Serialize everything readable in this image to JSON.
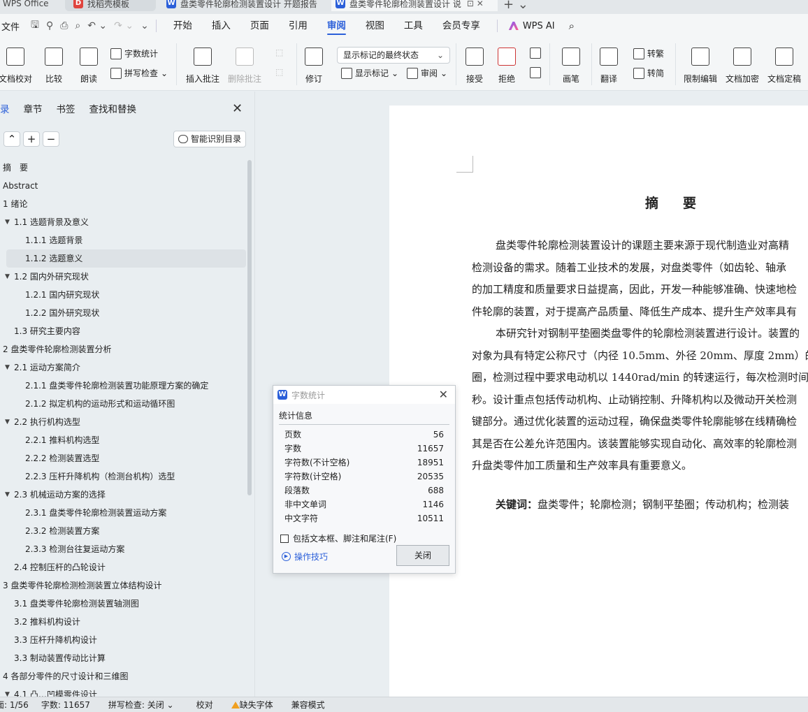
{
  "tabs": [
    {
      "label": "WPS Office"
    },
    {
      "label": "找稻壳模板"
    },
    {
      "label": "盘类零件轮廓检测装置设计 开题报告"
    },
    {
      "label": "盘类零件轮廓检测装置设计 说"
    }
  ],
  "menu": {
    "file": "文件",
    "items": [
      "开始",
      "插入",
      "页面",
      "引用",
      "审阅",
      "视图",
      "工具",
      "会员专享"
    ],
    "active": "审阅",
    "ai": "WPS AI"
  },
  "ribbon": {
    "doc_check": "文档校对",
    "compare": "比较",
    "read": "朗读",
    "word_count": "字数统计",
    "spell_check": "拼写检查",
    "insert_comment": "插入批注",
    "delete_comment": "删除批注",
    "revise": "修订",
    "markup_dropdown": "显示标记的最终状态",
    "show_markup": "显示标记",
    "review": "审阅",
    "accept": "接受",
    "reject": "拒绝",
    "pen": "画笔",
    "translate": "翻译",
    "to_traditional": "转繁",
    "to_simplified": "转简",
    "restrict_edit": "限制编辑",
    "encrypt": "文档加密",
    "finalize": "文档定稿"
  },
  "sidebar": {
    "tabs": [
      "录",
      "章节",
      "书签",
      "查找和替换"
    ],
    "smart_btn": "智能识别目录",
    "toc": [
      {
        "label": "摘　要",
        "level": 0,
        "arrow": false
      },
      {
        "label": "Abstract",
        "level": 0,
        "arrow": false
      },
      {
        "label": "1 绪论",
        "level": 0,
        "arrow": false
      },
      {
        "label": "1.1 选题背景及意义",
        "level": 1,
        "arrow": true
      },
      {
        "label": "1.1.1 选题背景",
        "level": 2,
        "arrow": false
      },
      {
        "label": "1.1.2 选题意义",
        "level": 2,
        "arrow": false,
        "selected": true
      },
      {
        "label": "1.2 国内外研究现状",
        "level": 1,
        "arrow": true
      },
      {
        "label": "1.2.1 国内研究现状",
        "level": 2,
        "arrow": false
      },
      {
        "label": "1.2.2 国外研究现状",
        "level": 2,
        "arrow": false
      },
      {
        "label": "1.3 研究主要内容",
        "level": 1,
        "arrow": false
      },
      {
        "label": "2 盘类零件轮廓检测装置分析",
        "level": 0,
        "arrow": false
      },
      {
        "label": "2.1 运动方案简介",
        "level": 1,
        "arrow": true
      },
      {
        "label": "2.1.1 盘类零件轮廓检测装置功能原理方案的确定",
        "level": 2,
        "arrow": false
      },
      {
        "label": "2.1.2 拟定机构的运动形式和运动循环图",
        "level": 2,
        "arrow": false
      },
      {
        "label": "2.2 执行机构选型",
        "level": 1,
        "arrow": true
      },
      {
        "label": "2.2.1 推料机构选型",
        "level": 2,
        "arrow": false
      },
      {
        "label": "2.2.2 检测装置选型",
        "level": 2,
        "arrow": false
      },
      {
        "label": "2.2.3 压杆升降机构（检测台机构）选型",
        "level": 2,
        "arrow": false
      },
      {
        "label": "2.3 机械运动方案的选择",
        "level": 1,
        "arrow": true
      },
      {
        "label": "2.3.1 盘类零件轮廓检测装置运动方案",
        "level": 2,
        "arrow": false
      },
      {
        "label": "2.3.2 检测装置方案",
        "level": 2,
        "arrow": false
      },
      {
        "label": "2.3.3 检测台往复运动方案",
        "level": 2,
        "arrow": false
      },
      {
        "label": "2.4 控制压杆的凸轮设计",
        "level": 1,
        "arrow": false
      },
      {
        "label": "3 盘类零件轮廓检测检测装置立体结构设计",
        "level": 0,
        "arrow": false
      },
      {
        "label": "3.1 盘类零件轮廓检测装置轴测图",
        "level": 1,
        "arrow": false
      },
      {
        "label": "3.2 推料机构设计",
        "level": 1,
        "arrow": false
      },
      {
        "label": "3.3 压杆升降机构设计",
        "level": 1,
        "arrow": false
      },
      {
        "label": "3.3 制动装置传动比计算",
        "level": 1,
        "arrow": false
      },
      {
        "label": "4 各部分零件的尺寸设计和三维图",
        "level": 0,
        "arrow": false
      },
      {
        "label": "4.1 凸…凹模零件设计",
        "level": 1,
        "arrow": true
      }
    ]
  },
  "document": {
    "title": "摘　要",
    "paragraphs": [
      [
        "盘类零件轮廓检测装置设计的课题主要来源于现代制造业对高精",
        "检测设备的需求。随着工业技术的发展，对盘类零件（如齿轮、轴承",
        "的加工精度和质量要求日益提高，因此，开发一种能够准确、快速地检",
        "件轮廓的装置，对于提高产品质量、降低生产成本、提升生产效率具有"
      ],
      [
        "本研究针对钢制平垫圈类盘零件的轮廓检测装置进行设计。装置的",
        "对象为具有特定公称尺寸（内径 10.5mm、外径 20mm、厚度 2mm）的",
        "圈，检测过程中要求电动机以 1440rad/min 的转速运行，每次检测时间",
        "秒。设计重点包括传动机构、止动销控制、升降机构以及微动开关检测",
        "键部分。通过优化装置的运动过程，确保盘类零件轮廓能够在线精确检",
        "其是否在公差允许范围内。该装置能够实现自动化、高效率的轮廓检测",
        "升盘类零件加工质量和生产效率具有重要意义。"
      ]
    ],
    "keywords_label": "关键词：",
    "keywords": "盘类零件；轮廓检测；钢制平垫圈；传动机构；检测装"
  },
  "dialog": {
    "title": "字数统计",
    "section": "统计信息",
    "stats": [
      {
        "label": "页数",
        "value": "56"
      },
      {
        "label": "字数",
        "value": "11657"
      },
      {
        "label": "字符数(不计空格)",
        "value": "18951"
      },
      {
        "label": "字符数(计空格)",
        "value": "20535"
      },
      {
        "label": "段落数",
        "value": "688"
      },
      {
        "label": "非中文单词",
        "value": "1146"
      },
      {
        "label": "中文字符",
        "value": "10511"
      }
    ],
    "checkbox": "包括文本框、脚注和尾注(F)",
    "tips": "操作技巧",
    "close": "关闭"
  },
  "status": {
    "page": "页面: 1/56",
    "words": "字数: 11657",
    "spell": "拼写检查: 关闭",
    "proof": "校对",
    "missing_font": "缺失字体",
    "compat": "兼容模式"
  },
  "colors": {
    "accent": "#2b5fd9",
    "warn": "#f0a020"
  }
}
